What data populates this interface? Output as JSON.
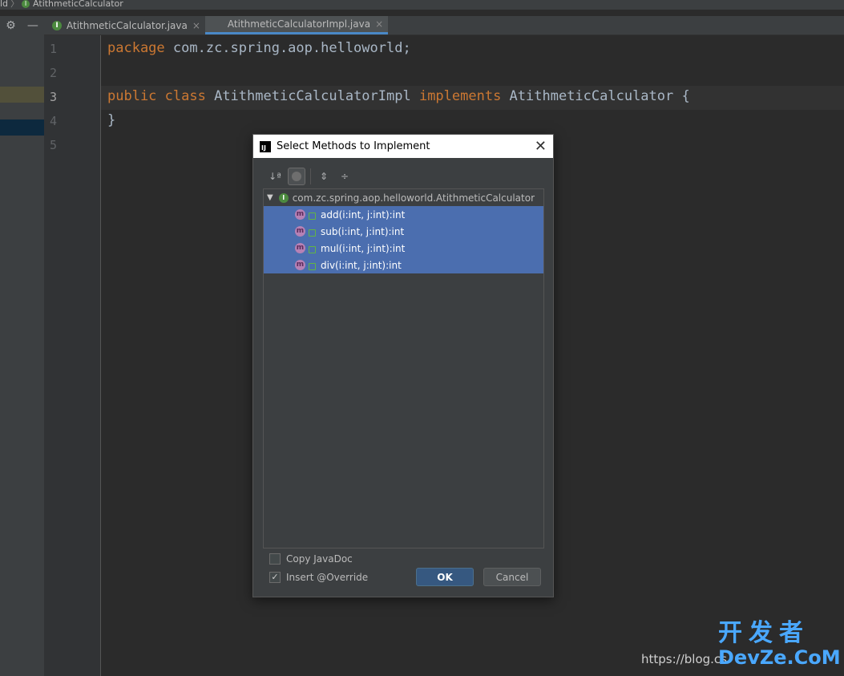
{
  "breadcrumb": {
    "part1": "ld",
    "part2": "AtithmeticCalculator",
    "icon": "I"
  },
  "tabs": [
    {
      "label": "AtithmeticCalculator.java",
      "icon": "I"
    },
    {
      "label": "AtithmeticCalculatorImpl.java"
    }
  ],
  "line_numbers": [
    "1",
    "2",
    "3",
    "4",
    "5"
  ],
  "code": {
    "line1_kw": "package",
    "line1_rest": " com.zc.spring.aop.helloworld;",
    "line3_kw1": "public",
    "line3_kw2": " class",
    "line3_name": " AtithmeticCalculatorImpl",
    "line3_kw3": " implements",
    "line3_rest": " AtithmeticCalculator {",
    "line4": "}"
  },
  "dialog": {
    "title": "Select Methods to Implement",
    "logo_text": "IJ",
    "root_node": "com.zc.spring.aop.helloworld.AtithmeticCalculator",
    "methods": [
      "add(i:int, j:int):int",
      "sub(i:int, j:int):int",
      "mul(i:int, j:int):int",
      "div(i:int, j:int):int"
    ],
    "method_icon": "m",
    "copy_javadoc": {
      "label": "Copy JavaDoc",
      "checked": false
    },
    "insert_override": {
      "label": "Insert @Override",
      "checked": true,
      "mark": "✓"
    },
    "ok_label": "OK",
    "cancel_label": "Cancel"
  },
  "watermark": {
    "url": "https://blog.cs",
    "brand_cn": "开发者",
    "brand": "DevZe.CoM"
  },
  "colors": {
    "keyword": "#cc7832",
    "selection": "#4b6eaf",
    "ok_button": "#365880"
  }
}
